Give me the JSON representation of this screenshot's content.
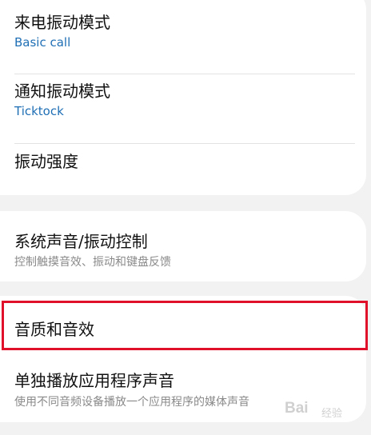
{
  "sections": [
    {
      "items": [
        {
          "title": "来电振动模式",
          "subtitle": "Basic call"
        },
        {
          "title": "通知振动模式",
          "subtitle": "Ticktock"
        },
        {
          "title": "振动强度"
        }
      ]
    },
    {
      "items": [
        {
          "title": "系统声音/振动控制",
          "subtitle": "控制触摸音效、振动和键盘反馈"
        }
      ]
    },
    {
      "items": [
        {
          "title": "音质和音效",
          "highlighted": true
        },
        {
          "title": "单独播放应用程序声音",
          "subtitle": "使用不同音频设备播放一个应用程序的媒体声音"
        }
      ]
    }
  ],
  "watermark": {
    "text": "Bai",
    "suffix": "经验"
  },
  "colors": {
    "highlight_border": "#e0102a",
    "subtitle_accent": "#1f6fb5",
    "subtitle_gray": "#8a8a8a",
    "background": "#f2f2f2"
  }
}
